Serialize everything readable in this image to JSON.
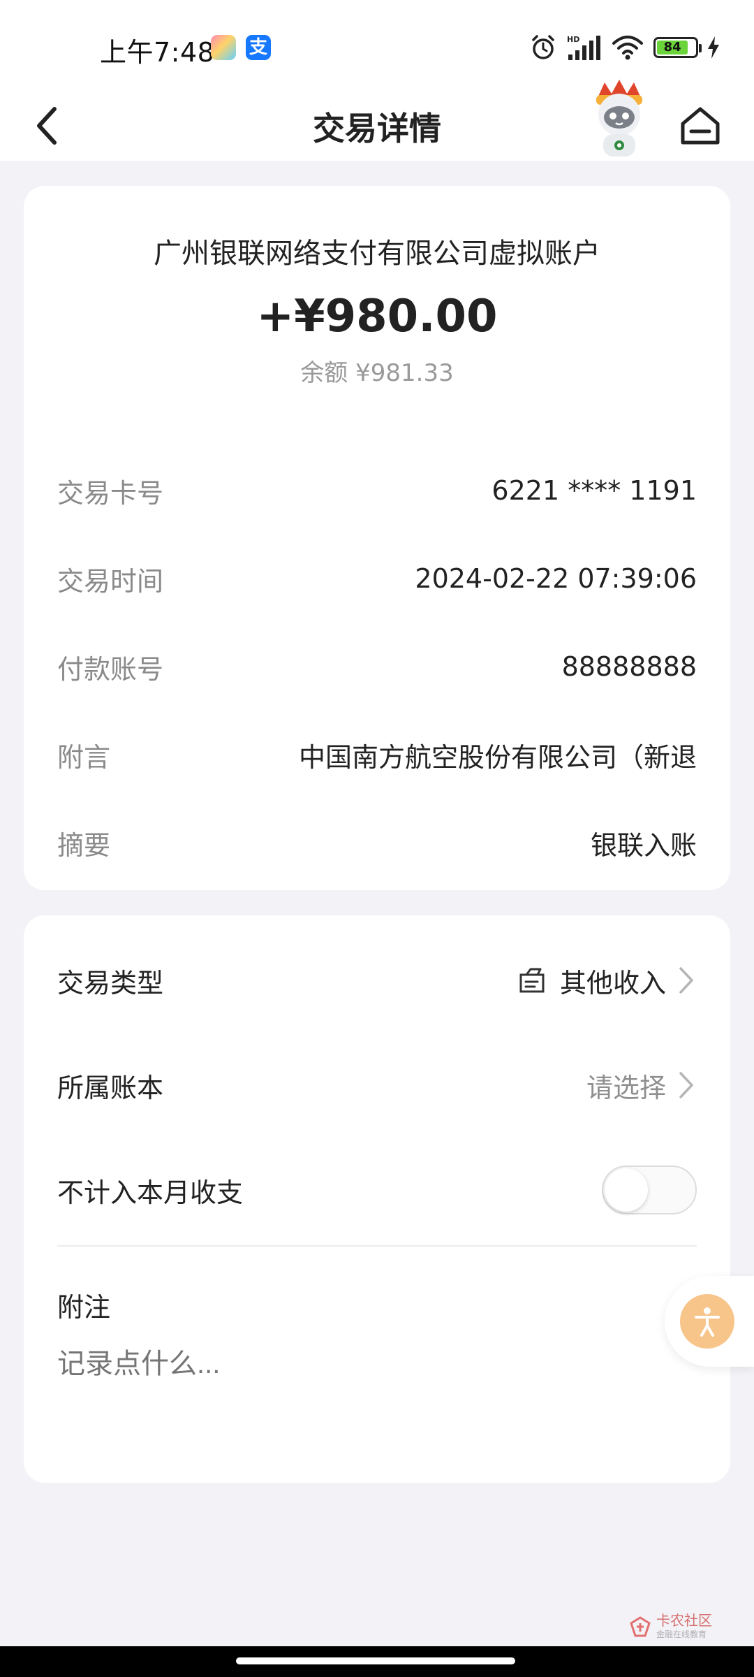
{
  "status_bar": {
    "time": "上午7:48",
    "battery": "84"
  },
  "nav": {
    "title": "交易详情"
  },
  "summary": {
    "payee": "广州银联网络支付有限公司虚拟账户",
    "amount": "+¥980.00",
    "balance": "余额 ¥981.33"
  },
  "details": [
    {
      "label": "交易卡号",
      "value": "6221 **** 1191"
    },
    {
      "label": "交易时间",
      "value": "2024-02-22 07:39:06"
    },
    {
      "label": "付款账号",
      "value": "88888888"
    },
    {
      "label": "附言",
      "value": "中国南方航空股份有限公司（新退"
    },
    {
      "label": "摘要",
      "value": "银联入账"
    }
  ],
  "settings": {
    "type_label": "交易类型",
    "type_value": "其他收入",
    "book_label": "所属账本",
    "book_value": "请选择",
    "exclude_label": "不计入本月收支",
    "exclude_enabled": false,
    "note_title": "附注",
    "note_placeholder": "记录点什么..."
  },
  "watermark": {
    "text": "卡农社区",
    "sub": "金融在线教育"
  },
  "icons": {
    "back": "chevron-left-icon",
    "home": "home-icon",
    "category": "receipt-icon",
    "accessibility": "accessibility-icon"
  }
}
